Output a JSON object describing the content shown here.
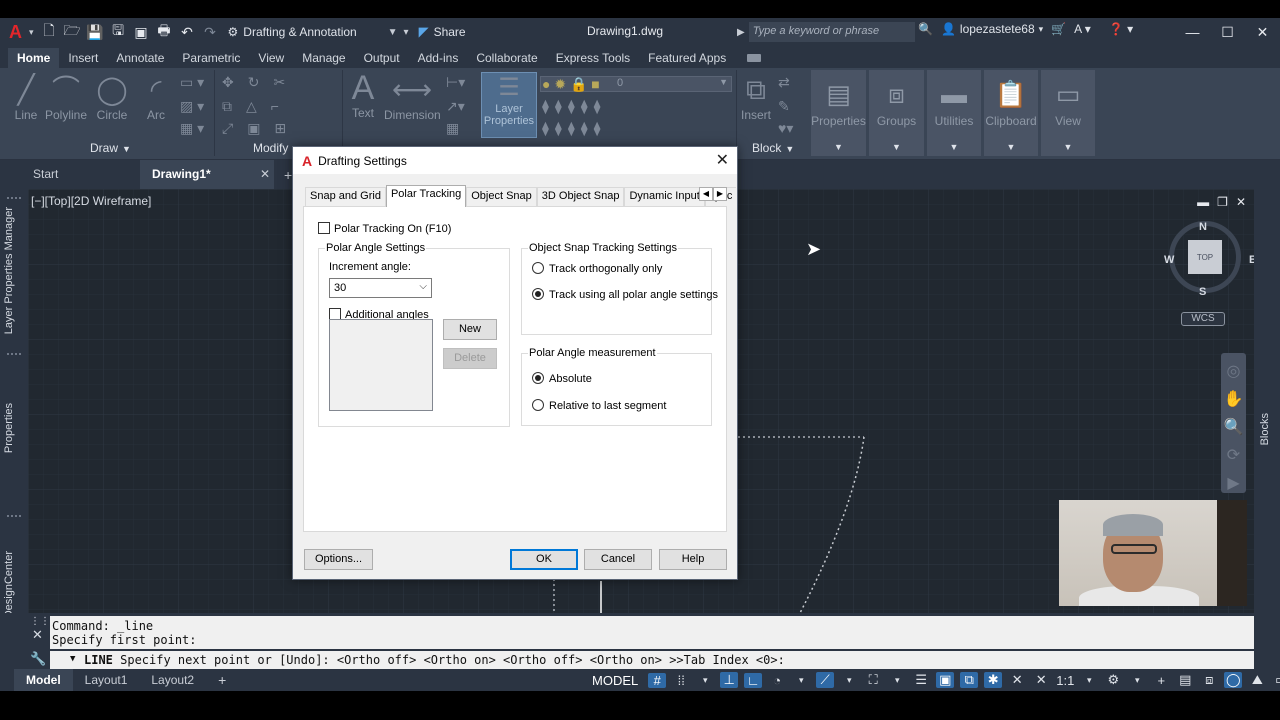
{
  "app": {
    "logo": "A",
    "workspace": "Drafting & Annotation",
    "share": "Share",
    "document_title": "Drawing1.dwg",
    "search_placeholder": "Type a keyword or phrase",
    "user": "lopezastete68"
  },
  "ribbon": {
    "tabs": [
      "Home",
      "Insert",
      "Annotate",
      "Parametric",
      "View",
      "Manage",
      "Output",
      "Add-ins",
      "Collaborate",
      "Express Tools",
      "Featured Apps"
    ],
    "active_tab": "Home",
    "draw_tools": [
      "Line",
      "Polyline",
      "Circle",
      "Arc"
    ],
    "annotation_tools": [
      "Text",
      "Dimension"
    ],
    "layer_properties": [
      "Layer",
      "Properties"
    ],
    "layer_value": "0",
    "insert": "Insert",
    "groups": [
      "Properties",
      "Groups",
      "Utilities",
      "Clipboard",
      "View"
    ],
    "panel_labels": {
      "draw": "Draw",
      "modify": "Modify",
      "block": "Block"
    }
  },
  "file_tabs": {
    "start": "Start",
    "active": "Drawing1*"
  },
  "viewport": {
    "label": "[−][Top][2D Wireframe]",
    "compass": {
      "n": "N",
      "s": "S",
      "e": "E",
      "w": "W",
      "top": "TOP"
    },
    "wcs": "WCS"
  },
  "palettes": {
    "left": [
      "Layer Properties Manager",
      "Properties",
      "DesignCenter"
    ],
    "right": [
      "Blocks"
    ]
  },
  "dialog": {
    "title": "Drafting Settings",
    "tabs": [
      "Snap and Grid",
      "Polar Tracking",
      "Object Snap",
      "3D Object Snap",
      "Dynamic Input",
      "Quic"
    ],
    "active_tab": "Polar Tracking",
    "polar_tracking_on": "Polar Tracking On (F10)",
    "polar_angle_settings": {
      "title": "Polar Angle Settings",
      "increment_label": "Increment angle:",
      "increment_value": "30",
      "additional_angles": "Additional angles",
      "new": "New",
      "delete": "Delete"
    },
    "object_snap_tracking": {
      "title": "Object Snap Tracking Settings",
      "orthogonal": "Track orthogonally only",
      "polar": "Track using all polar angle settings",
      "selected": "polar"
    },
    "polar_angle_measurement": {
      "title": "Polar Angle measurement",
      "absolute": "Absolute",
      "relative": "Relative to last segment",
      "selected": "absolute"
    },
    "buttons": {
      "options": "Options...",
      "ok": "OK",
      "cancel": "Cancel",
      "help": "Help"
    }
  },
  "command": {
    "history": [
      "Command: _line",
      "Specify first point:"
    ],
    "current_prefix": "LINE",
    "current": " Specify next point or [Undo]:  <Ortho off>  <Ortho on>  <Ortho off>  <Ortho on>  >>Tab Index <0>:"
  },
  "layouts": [
    "Model",
    "Layout1",
    "Layout2"
  ],
  "status": {
    "model": "MODEL",
    "scale": "1:1"
  }
}
